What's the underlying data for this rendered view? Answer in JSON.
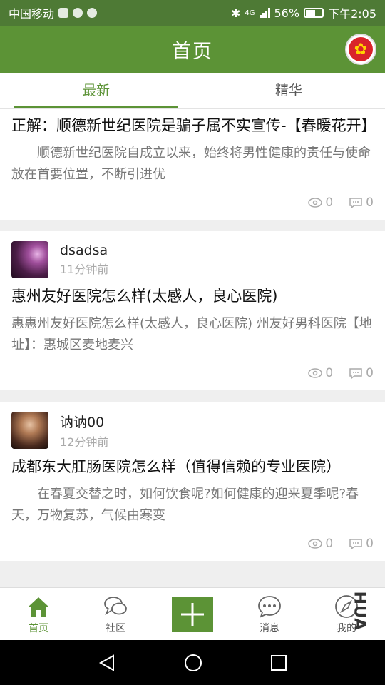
{
  "status_bar": {
    "carrier": "中国移动",
    "battery": "56%",
    "network": "4G",
    "time": "下午2:05"
  },
  "header": {
    "title": "首页",
    "avatar_icon": "flower-avatar-icon"
  },
  "tabs": [
    {
      "label": "最新",
      "active": true
    },
    {
      "label": "精华",
      "active": false
    }
  ],
  "posts": [
    {
      "title": "正解：顺德新世纪医院是骗子属不实宣传-【春暖花开】",
      "summary": "　　顺德新世纪医院自成立以来，始终将男性健康的责任与使命放在首要位置，不断引进优",
      "views": "0",
      "comments": "0"
    },
    {
      "user": "dsadsa",
      "time": "11分钟前",
      "title": "惠州友好医院怎么样(太感人，良心医院)",
      "summary": "惠惠州友好医院怎么样(太感人，良心医院) 州友好男科医院【地址】：惠城区麦地麦兴",
      "views": "0",
      "comments": "0"
    },
    {
      "user": "讷讷00",
      "time": "12分钟前",
      "title": "成都东大肛肠医院怎么样（值得信赖的专业医院）",
      "summary": "　　在春夏交替之时，如何饮食呢?如何健康的迎来夏季呢?春天，万物复苏，气候由寒变",
      "views": "0",
      "comments": "0"
    }
  ],
  "bottom_nav": {
    "home": "首页",
    "community": "社区",
    "messages": "消息",
    "mine": "我的",
    "watermark": "HUA"
  },
  "colors": {
    "primary": "#5c9336",
    "status_bar": "#4e7a35"
  }
}
